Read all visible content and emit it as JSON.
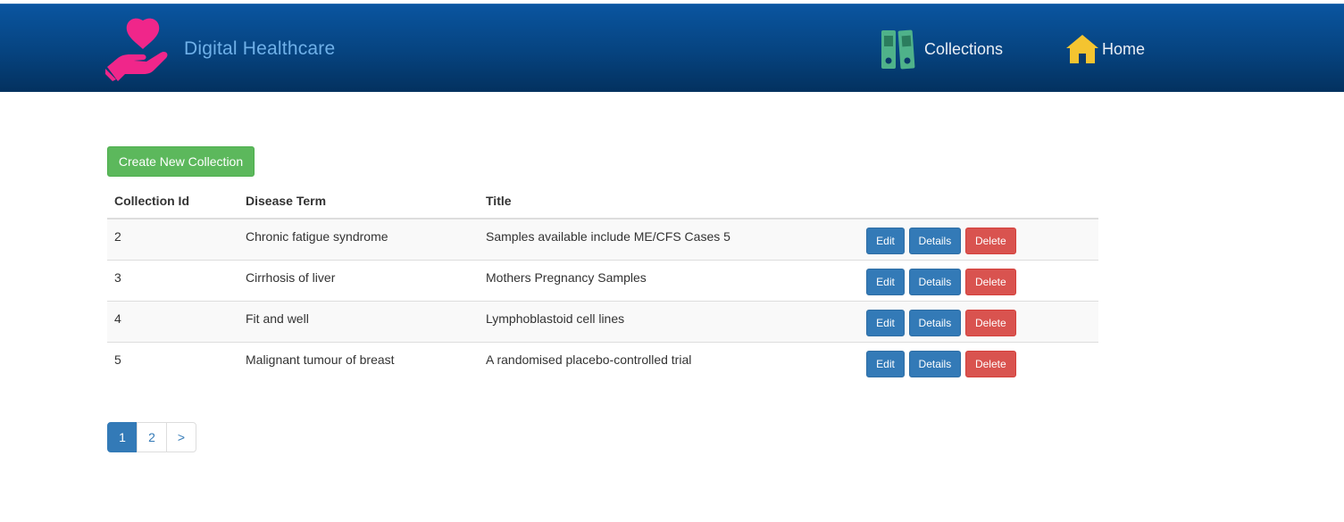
{
  "header": {
    "brand": "Digital Healthcare",
    "nav": {
      "collections_label": "Collections",
      "home_label": "Home"
    },
    "colors": {
      "navbar": "#06437f",
      "brand_text": "#6fb0e8",
      "logo": "#f0268a",
      "folders_icon": "#4fb28a",
      "home_icon": "#f4c430"
    }
  },
  "main": {
    "create_button_label": "Create New Collection",
    "table": {
      "headers": [
        "Collection Id",
        "Disease Term",
        "Title",
        ""
      ],
      "rows": [
        {
          "id": "2",
          "disease_term": "Chronic fatigue syndrome",
          "title": "Samples available include ME/CFS Cases 5"
        },
        {
          "id": "3",
          "disease_term": "Cirrhosis of liver",
          "title": "Mothers Pregnancy Samples"
        },
        {
          "id": "4",
          "disease_term": "Fit and well",
          "title": "Lymphoblastoid cell lines"
        },
        {
          "id": "5",
          "disease_term": "Malignant tumour of breast",
          "title": "A randomised placebo-controlled trial"
        }
      ],
      "actions": {
        "edit": "Edit",
        "details": "Details",
        "delete": "Delete"
      }
    },
    "pagination": {
      "pages": [
        "1",
        "2",
        ">"
      ],
      "active_page": "1"
    }
  }
}
